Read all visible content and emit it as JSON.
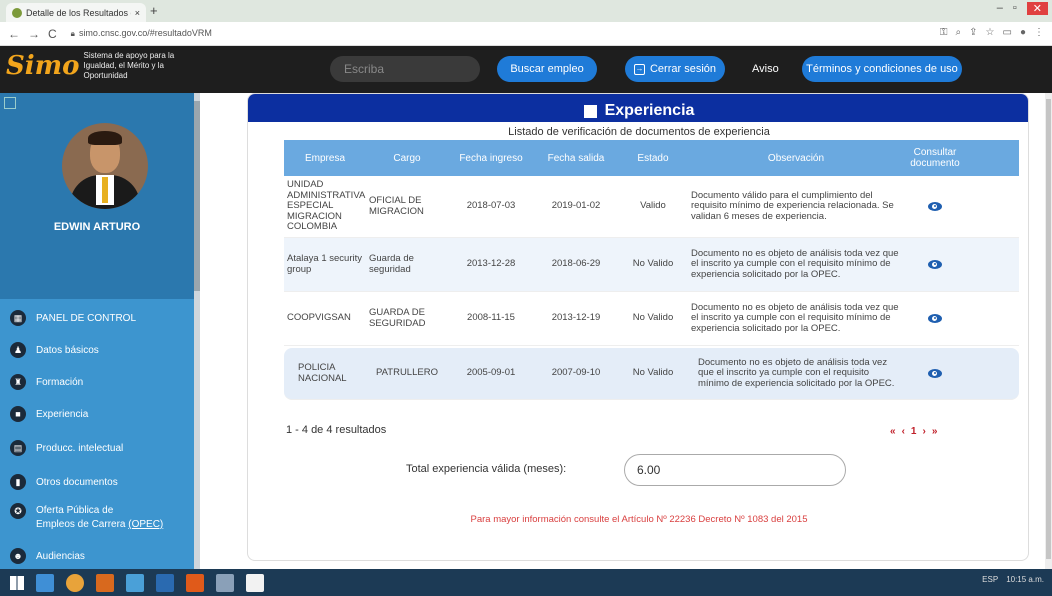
{
  "browser": {
    "tab_title": "Detalle de los Resultados de la ...",
    "tab_close": "×",
    "new_tab": "+",
    "url": "simo.cnsc.gov.co/#resultadoVRM",
    "win_min": "–",
    "win_max": "▫",
    "win_close": "✕",
    "nav_back": "←",
    "nav_forward": "→",
    "nav_reload": "C"
  },
  "header": {
    "logo_mark": "Simo",
    "logo_text": "Sistema de apoyo para la Igualdad, el Mérito y la Oportunidad",
    "search_placeholder": "Escriba",
    "buscar_label": "Buscar empleo",
    "cerrar_label": "Cerrar sesión",
    "aviso_label": "Aviso",
    "terminos_label": "Términos y condiciones de uso"
  },
  "sidebar": {
    "username": "EDWIN ARTURO",
    "items": [
      {
        "label": "PANEL DE CONTROL",
        "icon": "dashboard-icon"
      },
      {
        "label": "Datos básicos",
        "icon": "users-icon"
      },
      {
        "label": "Formación",
        "icon": "graduation-icon"
      },
      {
        "label": "Experiencia",
        "icon": "briefcase-icon"
      },
      {
        "label": "Producc. intelectual",
        "icon": "book-icon"
      },
      {
        "label": "Otros documentos",
        "icon": "document-icon"
      },
      {
        "label": "Oferta Pública de",
        "label2": "Empleos de Carrera",
        "label3": "(OPEC)",
        "icon": "globe-icon"
      },
      {
        "label": "Audiencias",
        "icon": "audience-icon"
      }
    ]
  },
  "main": {
    "section_title": "Experiencia",
    "list_title": "Listado de verificación de documentos de experiencia",
    "columns": [
      "Empresa",
      "Cargo",
      "Fecha ingreso",
      "Fecha salida",
      "Estado",
      "Observación",
      "Consultar documento"
    ],
    "rows": [
      {
        "empresa": "UNIDAD ADMINISTRATIVA ESPECIAL MIGRACION COLOMBIA",
        "cargo": "OFICIAL DE MIGRACION",
        "fecha_ingreso": "2018-07-03",
        "fecha_salida": "2019-01-02",
        "estado": "Valido",
        "observacion": "Documento válido para el cumplimiento del requisito mínimo de experiencia relacionada. Se validan 6 meses de experiencia."
      },
      {
        "empresa": "Atalaya 1 security group",
        "cargo": "Guarda de seguridad",
        "fecha_ingreso": "2013-12-28",
        "fecha_salida": "2018-06-29",
        "estado": "No Valido",
        "observacion": "Documento no es objeto de análisis toda vez que el inscrito ya cumple con el requisito mínimo de experiencia solicitado por la OPEC."
      },
      {
        "empresa": "COOPVIGSAN",
        "cargo": "GUARDA DE SEGURIDAD",
        "fecha_ingreso": "2008-11-15",
        "fecha_salida": "2013-12-19",
        "estado": "No Valido",
        "observacion": "Documento no es objeto de análisis toda vez que el inscrito ya cumple con el requisito mínimo de experiencia solicitado por la OPEC."
      },
      {
        "empresa": "POLICIA NACIONAL",
        "cargo": "PATRULLERO",
        "fecha_ingreso": "2005-09-01",
        "fecha_salida": "2007-09-10",
        "estado": "No Valido",
        "observacion": "Documento no es objeto de análisis toda vez que el inscrito ya cumple con el requisito mínimo de experiencia solicitado por la OPEC."
      }
    ],
    "results_text": "1 - 4 de 4 resultados",
    "pager": {
      "first": "«",
      "prev": "‹",
      "page": "1",
      "next": "›",
      "last": "»"
    },
    "total_label": "Total experiencia válida (meses):",
    "total_value": "6.00",
    "info_note": "Para mayor información consulte el Artículo Nº 22236 Decreto Nº 1083 del 2015"
  },
  "taskbar": {
    "tray_lang": "ESP",
    "tray_time": "10:15 a.m."
  },
  "colors": {
    "section_header": "#0c2fa0",
    "table_header": "#6aa9e0",
    "header_button": "#1f7bd8",
    "sidebar": "#2b7fb4",
    "pager": "#c0202a",
    "note": "#d94040"
  }
}
